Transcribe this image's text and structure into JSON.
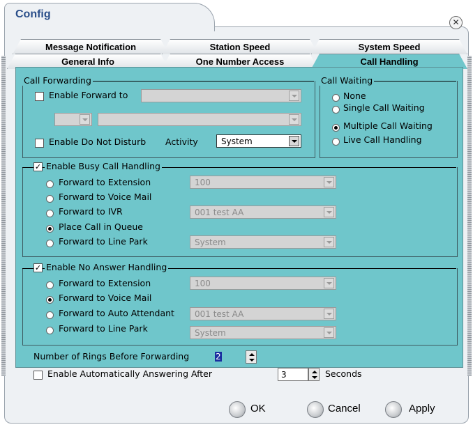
{
  "window": {
    "title": "Config"
  },
  "tabs": {
    "row1": [
      "Message Notification",
      "Station Speed",
      "System Speed"
    ],
    "row2": [
      "General Info",
      "One Number Access",
      "Call Handling"
    ],
    "active": "Call Handling"
  },
  "call_forwarding": {
    "title": "Call Forwarding",
    "enable_forward_label": "Enable Forward to",
    "forward_value": "",
    "dnd_label": "Enable Do Not Disturb",
    "activity_label": "Activity",
    "activity_value": "System"
  },
  "call_waiting": {
    "title": "Call Waiting",
    "options": [
      "None",
      "Single Call Waiting",
      "Multiple Call Waiting",
      "Live Call Handling"
    ],
    "selected": "Multiple Call Waiting"
  },
  "busy": {
    "title": "Enable Busy Call Handling",
    "checked": true,
    "options": [
      "Forward to Extension",
      "Forward to Voice Mail",
      "Forward to IVR",
      "Place Call in Queue",
      "Forward to Line Park"
    ],
    "selected": "Place Call in Queue",
    "ext_value": "100",
    "ivr_value": "001   test AA",
    "linepark_value": "System"
  },
  "no_answer": {
    "title": "Enable No Answer Handling",
    "checked": true,
    "options": [
      "Forward to Extension",
      "Forward to Voice Mail",
      "Forward to Auto Attendant",
      "Forward to Line Park"
    ],
    "selected": "Forward to Voice Mail",
    "ext_value": "100",
    "aa_value": "001   test AA",
    "linepark_value": "System"
  },
  "rings": {
    "label": "Number of Rings Before Forwarding",
    "value": "2"
  },
  "auto_answer": {
    "label": "Enable Automatically Answering After",
    "value": "3",
    "unit": "Seconds"
  },
  "buttons": {
    "ok": "OK",
    "cancel": "Cancel",
    "apply": "Apply"
  }
}
